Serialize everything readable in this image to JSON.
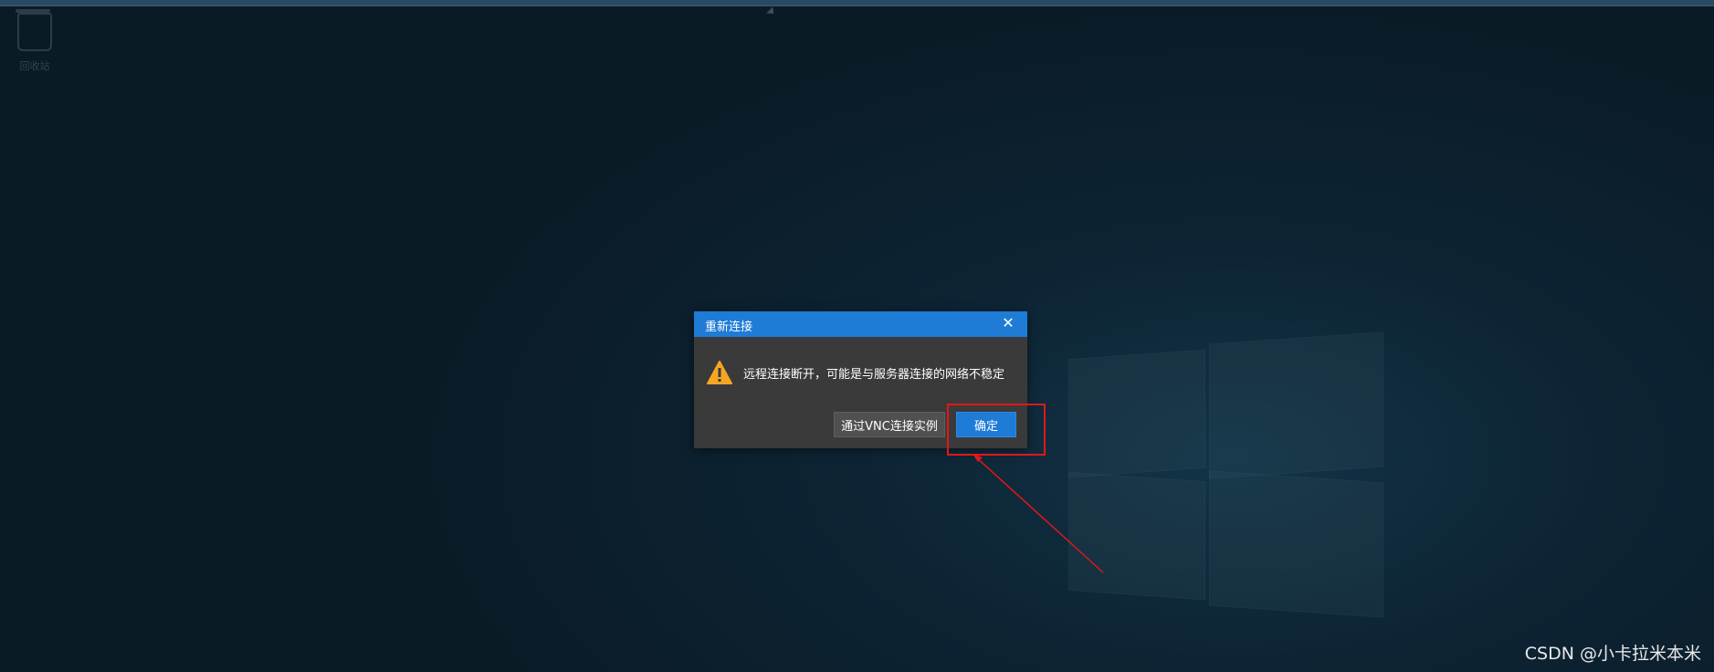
{
  "desktop": {
    "recycle_bin_label": "回收站"
  },
  "dialog": {
    "title": "重新连接",
    "close_symbol": "✕",
    "message": "远程连接断开，可能是与服务器连接的网络不稳定",
    "vnc_button_label": "通过VNC连接实例",
    "ok_button_label": "确定",
    "header_color": "#1e7bd6",
    "warning_color": "#f5a623"
  },
  "annotation": {
    "highlight_color": "#e01818"
  },
  "watermark": {
    "text": "CSDN @小卡拉米本米"
  }
}
